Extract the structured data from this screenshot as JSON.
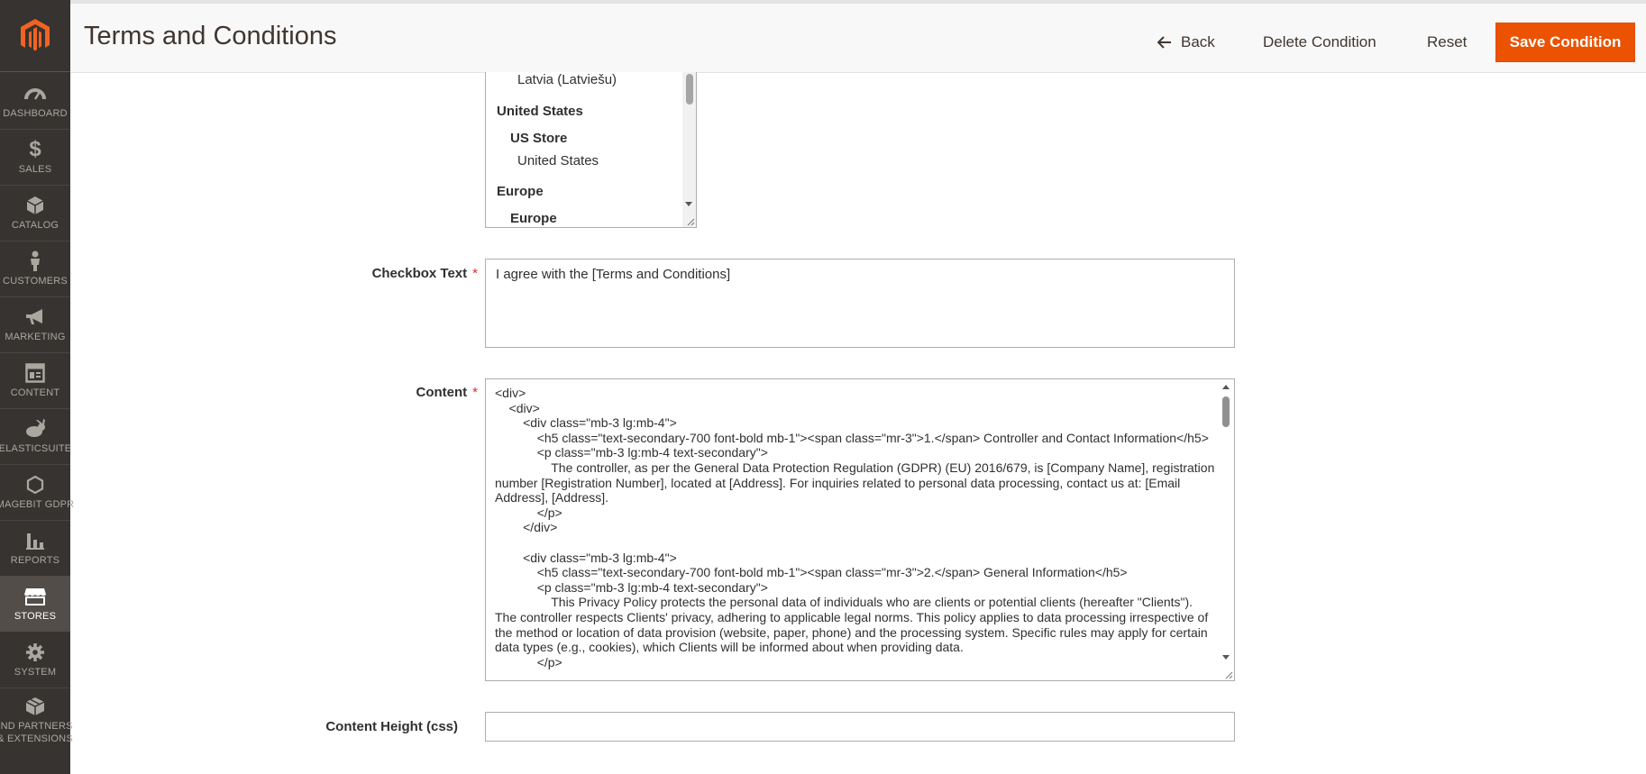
{
  "sidebar": {
    "items": [
      {
        "label": "DASHBOARD",
        "icon": "dashboard-icon"
      },
      {
        "label": "SALES",
        "icon": "dollar-icon"
      },
      {
        "label": "CATALOG",
        "icon": "cube-icon"
      },
      {
        "label": "CUSTOMERS",
        "icon": "person-icon"
      },
      {
        "label": "MARKETING",
        "icon": "megaphone-icon"
      },
      {
        "label": "CONTENT",
        "icon": "layout-icon"
      },
      {
        "label": "ELASTICSUITE",
        "icon": "rabbit-icon"
      },
      {
        "label": "MAGEBIT GDPR",
        "icon": "hexagon-icon"
      },
      {
        "label": "REPORTS",
        "icon": "bar-chart-icon"
      },
      {
        "label": "STORES",
        "icon": "store-icon"
      },
      {
        "label": "SYSTEM",
        "icon": "gear-icon"
      },
      {
        "label_line1": "IND PARTNERS",
        "label_line2": "& EXTENSIONS",
        "icon": "box-icon"
      }
    ],
    "active": "STORES"
  },
  "header": {
    "title": "Terms and Conditions",
    "back_label": "Back",
    "delete_label": "Delete Condition",
    "reset_label": "Reset",
    "save_label": "Save Condition"
  },
  "store_view": {
    "lines": [
      "Latvia (Latviešu)",
      "United States",
      "US Store",
      "United States",
      "Europe",
      "Europe"
    ]
  },
  "form": {
    "checkbox_text_label": "Checkbox Text",
    "checkbox_text_value": "I agree with the [Terms and Conditions]",
    "content_label": "Content",
    "content_value": "<div>\n    <div>\n        <div class=\"mb-3 lg:mb-4\">\n            <h5 class=\"text-secondary-700 font-bold mb-1\"><span class=\"mr-3\">1.</span> Controller and Contact Information</h5>\n            <p class=\"mb-3 lg:mb-4 text-secondary\">\n                The controller, as per the General Data Protection Regulation (GDPR) (EU) 2016/679, is [Company Name], registration number [Registration Number], located at [Address]. For inquiries related to personal data processing, contact us at: [Email Address], [Address].\n            </p>\n        </div>\n\n        <div class=\"mb-3 lg:mb-4\">\n            <h5 class=\"text-secondary-700 font-bold mb-1\"><span class=\"mr-3\">2.</span> General Information</h5>\n            <p class=\"mb-3 lg:mb-4 text-secondary\">\n                This Privacy Policy protects the personal data of individuals who are clients or potential clients (hereafter \"Clients\"). The controller respects Clients' privacy, adhering to applicable legal norms. This policy applies to data processing irrespective of the method or location of data provision (website, paper, phone) and the processing system. Specific rules may apply for certain data types (e.g., cookies), which Clients will be informed about when providing data.\n            </p>",
    "content_height_label": "Content Height (css)",
    "content_height_value": ""
  },
  "colors": {
    "sidebar_bg": "#373330",
    "accent": "#eb5202",
    "required": "#e22626"
  }
}
